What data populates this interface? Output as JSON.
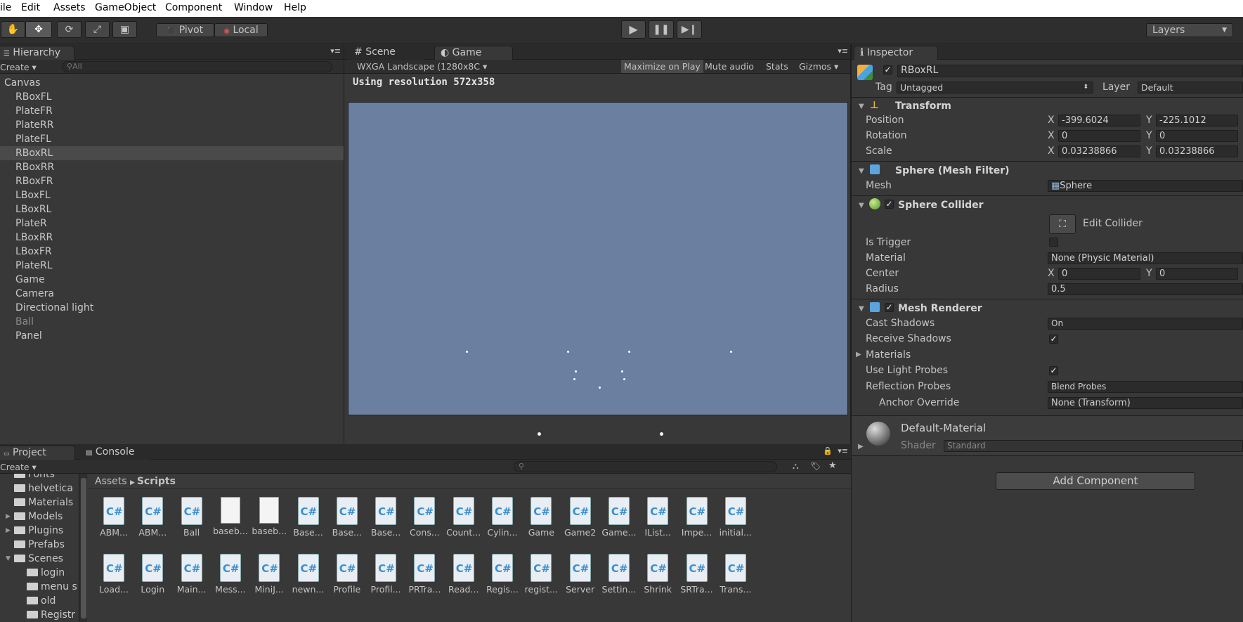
{
  "menu": [
    "ile",
    "Edit",
    "Assets",
    "GameObject",
    "Component",
    "Window",
    "Help"
  ],
  "toolbar": {
    "pivot": "Pivot",
    "local": "Local",
    "layers": "Layers"
  },
  "hierarchy": {
    "tab": "Hierarchy",
    "create": "Create",
    "search_placeholder": "All",
    "root": "Canvas",
    "items": [
      "RBoxFL",
      "PlateFR",
      "PlateRR",
      "PlateFL",
      "RBoxRL",
      "RBoxRR",
      "RBoxFR",
      "LBoxFL",
      "LBoxRL",
      "PlateR",
      "LBoxRR",
      "LBoxFR",
      "PlateRL",
      "Game",
      "Camera",
      "Directional light",
      "Ball",
      "Panel"
    ],
    "selected": "RBoxRL",
    "disabled": "Ball"
  },
  "scene": {
    "tab_scene": "Scene",
    "tab_game": "Game",
    "aspect": "WXGA Landscape (1280x8C",
    "maximize": "Maximize on Play",
    "mute": "Mute audio",
    "stats": "Stats",
    "gizmos": "Gizmos",
    "resolution_text": "Using resolution 572x358",
    "bg_color": "#6b7fa1"
  },
  "inspector": {
    "tab": "Inspector",
    "object_name": "RBoxRL",
    "tag_label": "Tag",
    "tag_value": "Untagged",
    "layer_label": "Layer",
    "layer_value": "Default",
    "transform": {
      "title": "Transform",
      "position_label": "Position",
      "rotation_label": "Rotation",
      "scale_label": "Scale",
      "pos_x": "-399.6024",
      "pos_y": "-225.1012",
      "rot_x": "0",
      "rot_y": "0",
      "scale_x": "0.03238866",
      "scale_y": "0.03238866"
    },
    "mesh_filter": {
      "title": "Sphere (Mesh Filter)",
      "mesh_label": "Mesh",
      "mesh_value": "Sphere"
    },
    "sphere_collider": {
      "title": "Sphere Collider",
      "edit_collider": "Edit Collider",
      "is_trigger_label": "Is Trigger",
      "material_label": "Material",
      "material_value": "None (Physic Material)",
      "center_label": "Center",
      "center_x": "0",
      "center_y": "0",
      "radius_label": "Radius",
      "radius_value": "0.5"
    },
    "mesh_renderer": {
      "title": "Mesh Renderer",
      "cast_shadows_label": "Cast Shadows",
      "cast_shadows_value": "On",
      "receive_shadows_label": "Receive Shadows",
      "materials_label": "Materials",
      "light_probes_label": "Use Light Probes",
      "reflection_label": "Reflection Probes",
      "reflection_value": "Blend Probes",
      "anchor_label": "Anchor Override",
      "anchor_value": "None (Transform)"
    },
    "material": {
      "name": "Default-Material",
      "shader_label": "Shader",
      "shader_value": "Standard"
    },
    "add_component": "Add Component",
    "x": "X",
    "y": "Y"
  },
  "project": {
    "tab_project": "Project",
    "tab_console": "Console",
    "create": "Create",
    "breadcrumb_root": "Assets",
    "breadcrumb_current": "Scripts",
    "folders": [
      {
        "name": "Fonts",
        "indent": 1
      },
      {
        "name": "helvetica",
        "indent": 1
      },
      {
        "name": "Materials",
        "indent": 1
      },
      {
        "name": "Models",
        "indent": 1,
        "arrow": true
      },
      {
        "name": "Plugins",
        "indent": 1,
        "arrow": true
      },
      {
        "name": "Prefabs",
        "indent": 1
      },
      {
        "name": "Scenes",
        "indent": 1,
        "open": true
      },
      {
        "name": "login",
        "indent": 2
      },
      {
        "name": "menu s",
        "indent": 2
      },
      {
        "name": "old",
        "indent": 2
      },
      {
        "name": "Registr",
        "indent": 2
      }
    ],
    "assets_row1": [
      {
        "name": "ABM...",
        "type": "cs"
      },
      {
        "name": "ABM...",
        "type": "cs"
      },
      {
        "name": "Ball",
        "type": "cs"
      },
      {
        "name": "baseb...",
        "type": "doc"
      },
      {
        "name": "baseb...",
        "type": "doc"
      },
      {
        "name": "Base...",
        "type": "cs"
      },
      {
        "name": "Base...",
        "type": "cs"
      },
      {
        "name": "Base...",
        "type": "cs"
      },
      {
        "name": "Cons...",
        "type": "cs"
      },
      {
        "name": "Count...",
        "type": "cs"
      },
      {
        "name": "Cylin...",
        "type": "cs"
      },
      {
        "name": "Game",
        "type": "cs"
      },
      {
        "name": "Game2",
        "type": "cs"
      },
      {
        "name": "Game...",
        "type": "cs"
      },
      {
        "name": "IList...",
        "type": "cs"
      },
      {
        "name": "Impe...",
        "type": "cs"
      },
      {
        "name": "initial...",
        "type": "cs"
      }
    ],
    "assets_row2": [
      {
        "name": "Load...",
        "type": "cs"
      },
      {
        "name": "Login",
        "type": "cs"
      },
      {
        "name": "Main...",
        "type": "cs"
      },
      {
        "name": "Mess...",
        "type": "cs"
      },
      {
        "name": "MiniJ...",
        "type": "cs"
      },
      {
        "name": "newn...",
        "type": "cs"
      },
      {
        "name": "Profile",
        "type": "cs"
      },
      {
        "name": "Profil...",
        "type": "cs"
      },
      {
        "name": "PRTra...",
        "type": "cs"
      },
      {
        "name": "Read...",
        "type": "cs"
      },
      {
        "name": "Regis...",
        "type": "cs"
      },
      {
        "name": "regist...",
        "type": "cs"
      },
      {
        "name": "Server",
        "type": "cs"
      },
      {
        "name": "Settin...",
        "type": "cs"
      },
      {
        "name": "Shrink",
        "type": "cs"
      },
      {
        "name": "SRTra...",
        "type": "cs"
      },
      {
        "name": "Trans...",
        "type": "cs"
      }
    ]
  }
}
